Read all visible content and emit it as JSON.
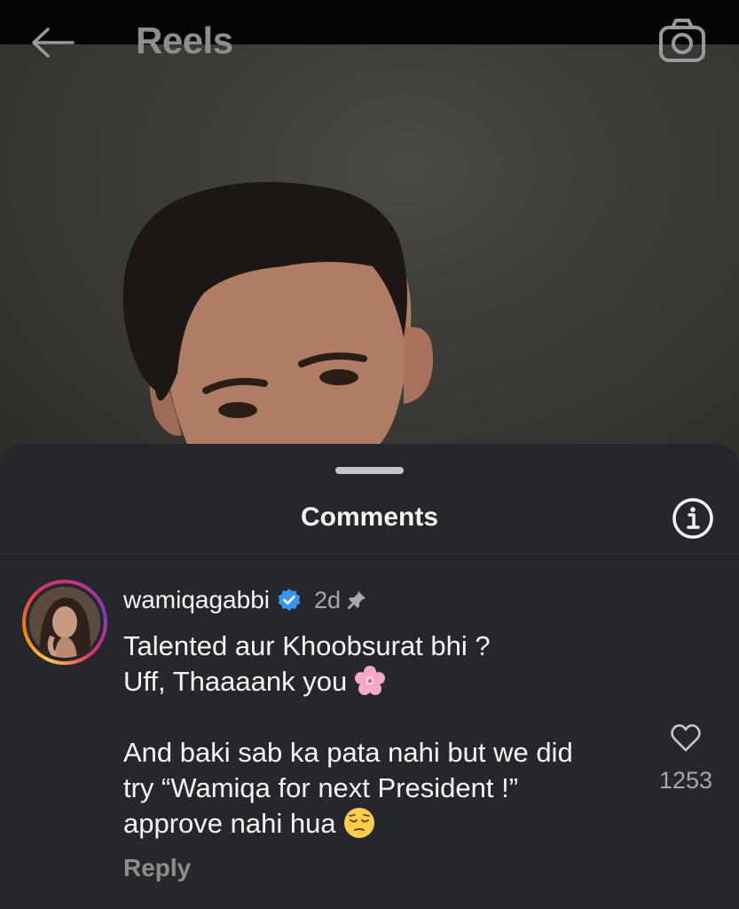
{
  "header": {
    "title": "Reels",
    "back_icon": "arrow-left-icon",
    "camera_icon": "camera-icon"
  },
  "comments_sheet": {
    "title": "Comments",
    "info_icon": "info-icon"
  },
  "comment": {
    "username": "wamiqagabbi",
    "verified": true,
    "time": "2d",
    "pinned": true,
    "text_lines": [
      "Talented aur Khoobsurat bhi ?",
      "Uff, Thaaaank you",
      "",
      "And baki sab ka pata nahi but we did",
      "try “Wamiqa for next President !”",
      "approve nahi hua"
    ],
    "reply_label": "Reply",
    "like_count": "1253",
    "emojis": [
      "cherry-blossom",
      "pensive-face"
    ]
  },
  "colors": {
    "sheet_bg": "#25272c",
    "verified_blue": "#3897f0",
    "muted_text": "#a8a8a8"
  }
}
